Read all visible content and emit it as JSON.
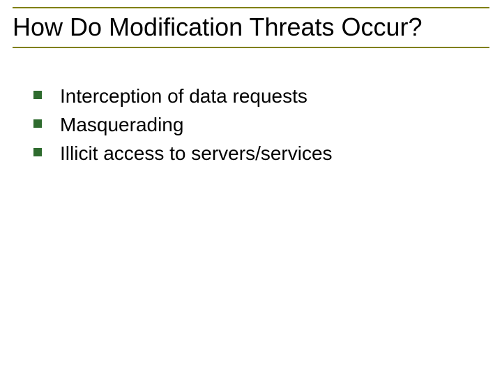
{
  "title": "How Do Modification Threats Occur?",
  "bullets": [
    "Interception of data requests",
    "Masquerading",
    "Illicit access to servers/services"
  ],
  "colors": {
    "rule": "#808000",
    "bullet": "#2e6b2e",
    "text": "#000000"
  }
}
